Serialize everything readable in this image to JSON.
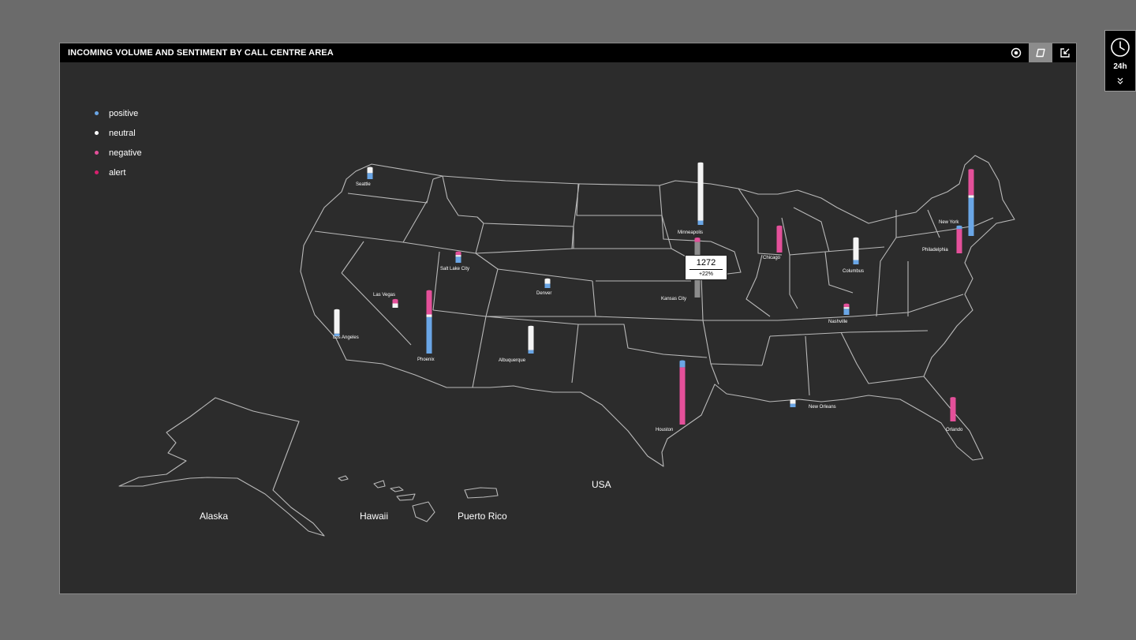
{
  "header": {
    "title": "INCOMING VOLUME AND SENTIMENT BY CALL CENTRE AREA"
  },
  "toolbar": {
    "icons": [
      "target-icon",
      "map-view-icon",
      "export-icon"
    ]
  },
  "legend": [
    {
      "label": "positive",
      "color": "#6aa6e6"
    },
    {
      "label": "neutral",
      "color": "#ffffff"
    },
    {
      "label": "negative",
      "color": "#e4509a"
    },
    {
      "label": "alert",
      "color": "#d8206e"
    }
  ],
  "time_range": {
    "label": "24h"
  },
  "colors": {
    "positive": "#6aa6e6",
    "neutral": "#f4f4f4",
    "negative": "#e4509a",
    "alert": "#d8206e",
    "selected": "#8c8c8c"
  },
  "tooltip": {
    "city": "Kansas City",
    "value": "1272",
    "change": "+22%"
  },
  "cities": [
    {
      "name": "Seattle",
      "segments": [
        [
          "positive",
          0.7
        ],
        [
          "neutral",
          0.6
        ]
      ]
    },
    {
      "name": "Minneapolis",
      "segments": [
        [
          "positive",
          0.5
        ],
        [
          "neutral",
          6.6
        ]
      ]
    },
    {
      "name": "New York",
      "segments": [
        [
          "positive",
          4.4
        ],
        [
          "neutral",
          0.3
        ],
        [
          "negative",
          2.9
        ]
      ]
    },
    {
      "name": "Chicago",
      "segments": [
        [
          "negative",
          3.0
        ]
      ]
    },
    {
      "name": "Philadelphia",
      "segments": [
        [
          "negative",
          2.8
        ],
        [
          "positive",
          0.3
        ]
      ]
    },
    {
      "name": "Columbus",
      "segments": [
        [
          "positive",
          0.5
        ],
        [
          "neutral",
          2.5
        ]
      ]
    },
    {
      "name": "Salt Lake City",
      "segments": [
        [
          "positive",
          0.7
        ],
        [
          "neutral",
          0.2
        ],
        [
          "negative",
          0.3
        ]
      ]
    },
    {
      "name": "Denver",
      "segments": [
        [
          "positive",
          0.5
        ],
        [
          "neutral",
          0.5
        ]
      ]
    },
    {
      "name": "Kansas City",
      "segments": [
        [
          "selected",
          6.4
        ],
        [
          "negative",
          0.4
        ]
      ]
    },
    {
      "name": "Las Vegas",
      "segments": [
        [
          "neutral",
          0.5
        ],
        [
          "negative",
          0.4
        ]
      ]
    },
    {
      "name": "Los Angeles",
      "segments": [
        [
          "positive",
          0.3
        ],
        [
          "neutral",
          2.7
        ]
      ]
    },
    {
      "name": "Phoenix",
      "segments": [
        [
          "positive",
          4.2
        ],
        [
          "neutral",
          0.3
        ],
        [
          "negative",
          2.7
        ]
      ]
    },
    {
      "name": "Albuquerque",
      "segments": [
        [
          "positive",
          0.4
        ],
        [
          "neutral",
          2.7
        ]
      ]
    },
    {
      "name": "Nashville",
      "segments": [
        [
          "positive",
          0.7
        ],
        [
          "neutral",
          0.2
        ],
        [
          "negative",
          0.3
        ]
      ]
    },
    {
      "name": "Houston",
      "segments": [
        [
          "negative",
          6.6
        ],
        [
          "positive",
          0.7
        ]
      ]
    },
    {
      "name": "New Orleans",
      "segments": [
        [
          "positive",
          0.4
        ],
        [
          "neutral",
          0.4
        ]
      ]
    },
    {
      "name": "Orlando",
      "segments": [
        [
          "negative",
          2.7
        ]
      ]
    }
  ],
  "regions": {
    "usa": "USA",
    "alaska": "Alaska",
    "hawaii": "Hawaii",
    "puerto_rico": "Puerto Rico"
  }
}
